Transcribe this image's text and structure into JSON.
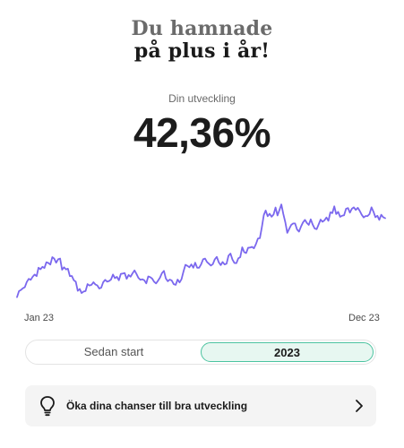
{
  "headline": {
    "line1": "Du hamnade",
    "line2": "på plus i år!"
  },
  "summary": {
    "label": "Din utveckling",
    "value": "42,36%"
  },
  "chart_data": {
    "type": "line",
    "title": "",
    "xlabel": "",
    "ylabel": "",
    "x_tick_labels": [
      "Jan 23",
      "Dec 23"
    ],
    "ylim": [
      -2,
      46
    ],
    "grid": false,
    "legend": "none",
    "color": "#7b68ee",
    "series": [
      {
        "values": [
          0.0,
          2.5,
          3.0,
          3.7,
          4.1,
          6.3,
          7.6,
          7.2,
          8.5,
          9.4,
          8.7,
          12.2,
          11.6,
          12.6,
          12.1,
          14.5,
          14.2,
          13.5,
          16.6,
          16.0,
          14.3,
          15.7,
          16.0,
          11.4,
          12.4,
          11.5,
          11.8,
          8.7,
          8.8,
          7.0,
          6.4,
          2.6,
          3.4,
          1.7,
          2.3,
          2.5,
          5.4,
          4.8,
          5.1,
          6.2,
          5.3,
          4.9,
          3.6,
          3.9,
          6.2,
          7.2,
          6.4,
          6.7,
          7.3,
          9.4,
          7.9,
          8.4,
          7.0,
          9.7,
          9.8,
          10.0,
          7.6,
          9.2,
          8.5,
          9.9,
          11.1,
          9.6,
          8.0,
          7.2,
          7.4,
          7.0,
          5.7,
          8.6,
          8.3,
          7.7,
          6.4,
          5.7,
          6.8,
          8.1,
          10.0,
          10.9,
          7.8,
          6.6,
          7.3,
          6.9,
          5.4,
          5.1,
          7.3,
          6.1,
          7.4,
          10.6,
          13.4,
          13.0,
          12.4,
          13.6,
          12.2,
          14.3,
          12.2,
          12.2,
          13.6,
          15.7,
          16.0,
          14.6,
          13.9,
          13.1,
          13.7,
          15.7,
          16.7,
          14.5,
          13.3,
          14.6,
          13.6,
          13.9,
          17.2,
          18.1,
          15.6,
          14.2,
          14.1,
          16.1,
          16.6,
          20.7,
          18.7,
          18.3,
          20.5,
          20.6,
          20.9,
          20.3,
          22.0,
          24.3,
          24.5,
          29.0,
          34.1,
          36.0,
          33.6,
          34.6,
          33.4,
          34.3,
          37.2,
          33.9,
          36.1,
          38.5,
          34.5,
          31.1,
          26.7,
          28.4,
          30.0,
          30.6,
          30.6,
          28.1,
          27.2,
          29.3,
          31.0,
          32.1,
          30.8,
          30.0,
          32.3,
          30.1,
          28.5,
          28.2,
          30.2,
          32.2,
          31.3,
          31.9,
          33.1,
          31.7,
          35.2,
          34.9,
          37.7,
          34.5,
          35.4,
          33.4,
          33.8,
          34.0,
          36.7,
          37.0,
          35.1,
          36.7,
          37.3,
          36.2,
          37.1,
          35.8,
          34.2,
          33.1,
          33.7,
          33.7,
          34.5,
          37.3,
          35.5,
          33.2,
          33.8,
          32.1,
          34.2,
          33.2,
          32.8
        ]
      }
    ]
  },
  "period_selector": {
    "options": [
      {
        "label": "Sedan start",
        "selected": false
      },
      {
        "label": "2023",
        "selected": true
      }
    ]
  },
  "tip": {
    "icon": "lightbulb-icon",
    "text": "Öka dina chanser till bra utveckling",
    "action_icon": "chevron-right-icon"
  }
}
